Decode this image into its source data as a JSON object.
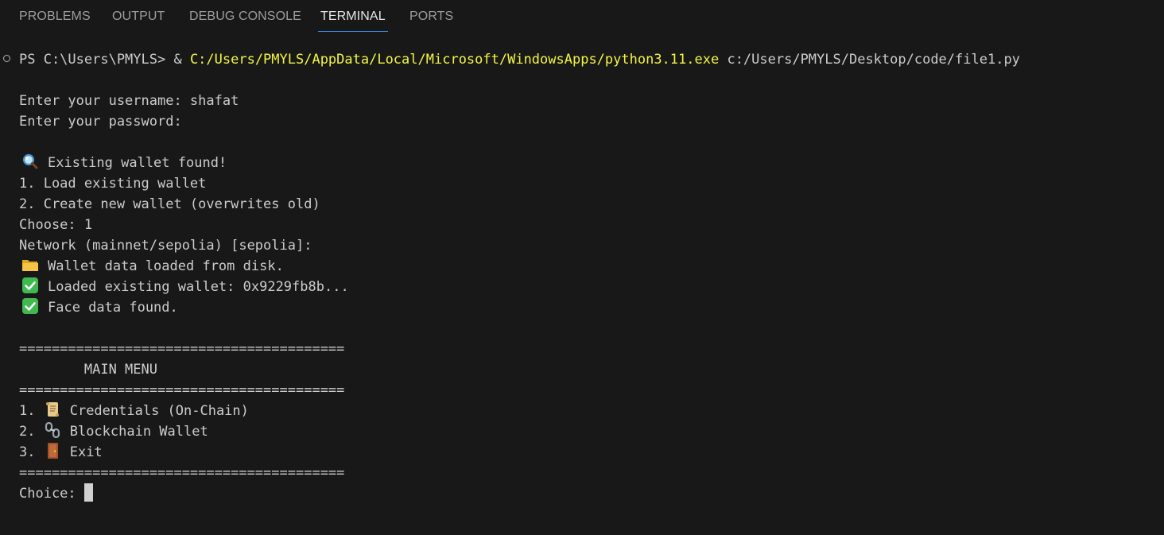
{
  "tabs": [
    {
      "label": "PROBLEMS"
    },
    {
      "label": "OUTPUT"
    },
    {
      "label": "DEBUG CONSOLE"
    },
    {
      "label": "TERMINAL",
      "active": true
    },
    {
      "label": "PORTS"
    }
  ],
  "colors": {
    "background": "#181818",
    "text": "#cccccc",
    "path_highlight": "#f5f543",
    "active_tab_underline": "#3b8eea"
  },
  "terminal": {
    "prompt": "PS C:\\Users\\PMYLS> & ",
    "python_path": "C:/Users/PMYLS/AppData/Local/Microsoft/WindowsApps/python3.11.exe",
    "script_path": " c:/Users/PMYLS/Desktop/code/file1.py",
    "lines": {
      "username": "Enter your username: shafat",
      "password": "Enter your password:",
      "wallet_found": "Existing wallet found!",
      "opt1": "1. Load existing wallet",
      "opt2": "2. Create new wallet (overwrites old)",
      "choose": "Choose: 1",
      "network": "Network (mainnet/sepolia) [sepolia]:",
      "loaded_disk": "Wallet data loaded from disk.",
      "loaded_wallet": "Loaded existing wallet: 0x9229fb8b...",
      "face_found": "Face data found.",
      "sep1": "========================================",
      "menu_title": "        MAIN MENU",
      "sep2": "========================================",
      "menu1_num": "1. ",
      "menu1_text": "Credentials (On-Chain)",
      "menu2_num": "2. ",
      "menu2_text": "Blockchain Wallet",
      "menu3_num": "3. ",
      "menu3_text": "Exit",
      "sep3": "========================================",
      "choice": "Choice: "
    },
    "icons": {
      "wallet_found": "magnifying-glass-icon",
      "loaded_disk": "folder-icon",
      "loaded_wallet": "check-mark-icon",
      "face_found": "check-mark-icon",
      "menu1": "scroll-icon",
      "menu2": "chains-icon",
      "menu3": "door-icon"
    }
  }
}
